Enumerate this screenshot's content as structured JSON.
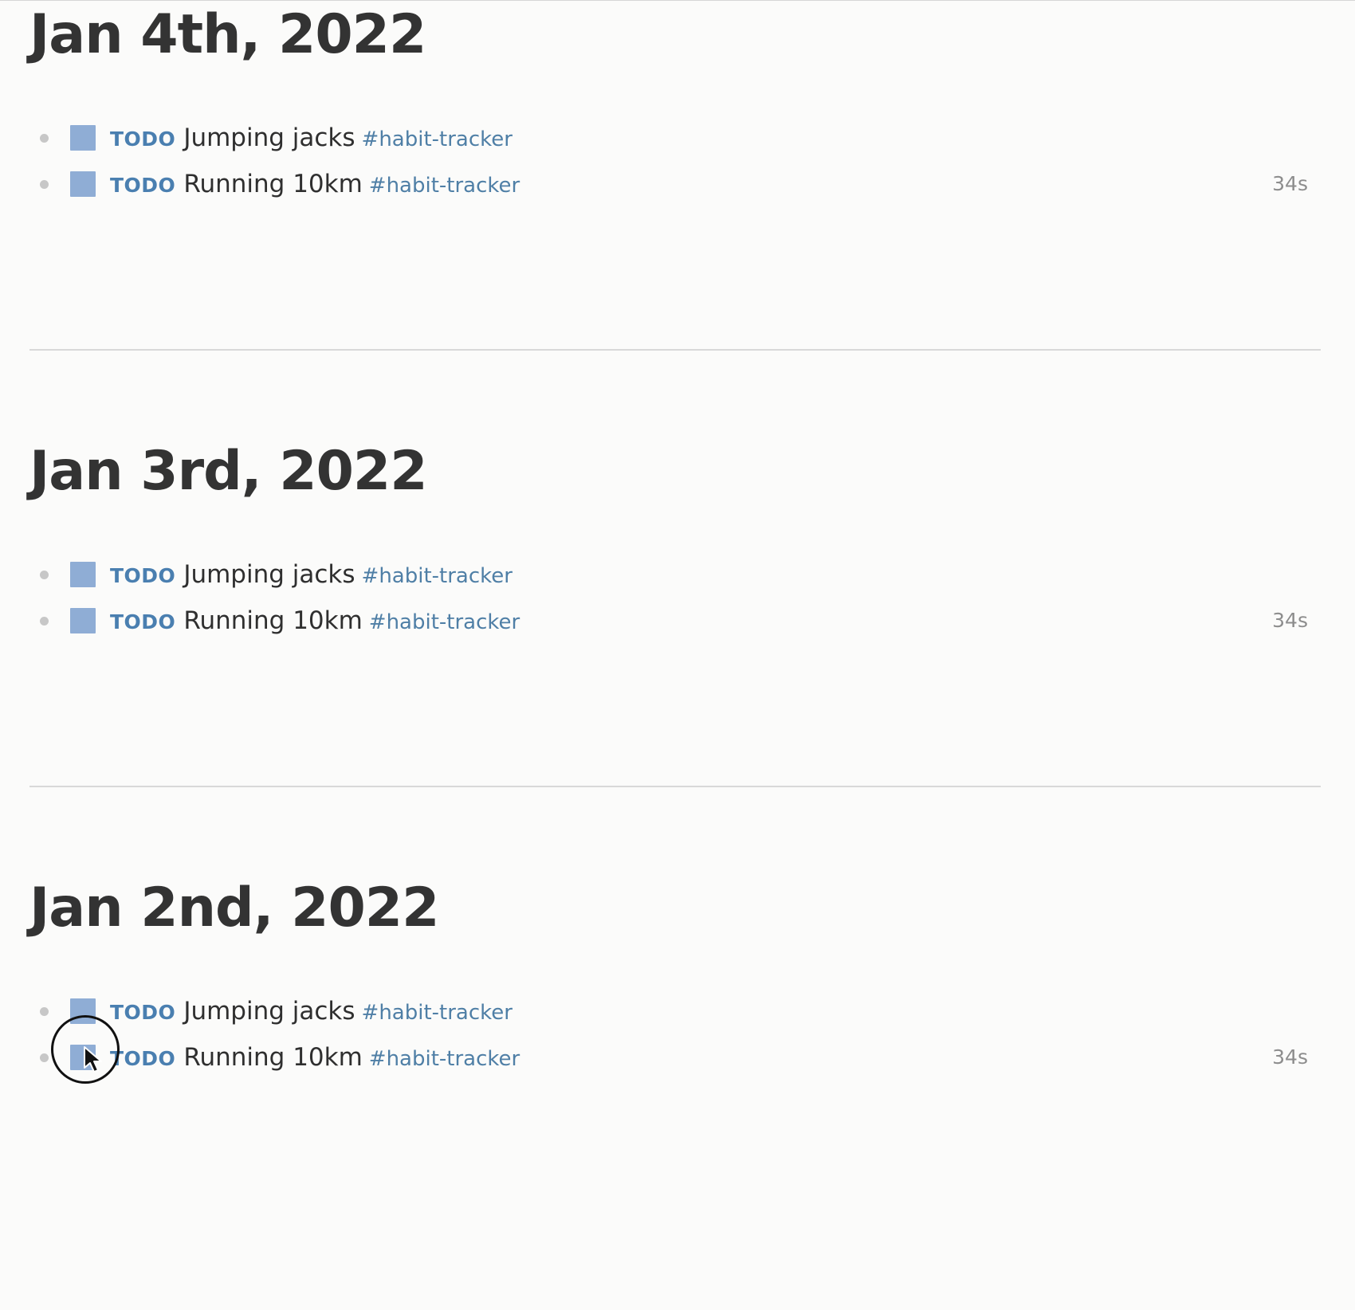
{
  "journal": {
    "days": [
      {
        "title": "Jan 4th, 2022",
        "blocks": [
          {
            "marker": "TODO",
            "text": "Jumping jacks",
            "tag": "#habit-tracker",
            "timer": ""
          },
          {
            "marker": "TODO",
            "text": "Running 10km",
            "tag": "#habit-tracker",
            "timer": "34s"
          }
        ]
      },
      {
        "title": "Jan 3rd, 2022",
        "blocks": [
          {
            "marker": "TODO",
            "text": "Jumping jacks",
            "tag": "#habit-tracker",
            "timer": ""
          },
          {
            "marker": "TODO",
            "text": "Running 10km",
            "tag": "#habit-tracker",
            "timer": "34s"
          }
        ]
      },
      {
        "title": "Jan 2nd, 2022",
        "blocks": [
          {
            "marker": "TODO",
            "text": "Jumping jacks",
            "tag": "#habit-tracker",
            "timer": ""
          },
          {
            "marker": "TODO",
            "text": "Running 10km",
            "tag": "#habit-tracker",
            "timer": "34s"
          }
        ]
      }
    ]
  },
  "colors": {
    "background": "#fbfbfa",
    "checkbox": "#8fadd5",
    "todo_marker": "#4a7fb0",
    "tag": "#4f7fa6",
    "timer": "#8d8d8d"
  },
  "icons": {
    "bullet": "bullet-dot-icon",
    "checkbox": "checkbox-icon",
    "cursor": "mouse-pointer-icon"
  }
}
